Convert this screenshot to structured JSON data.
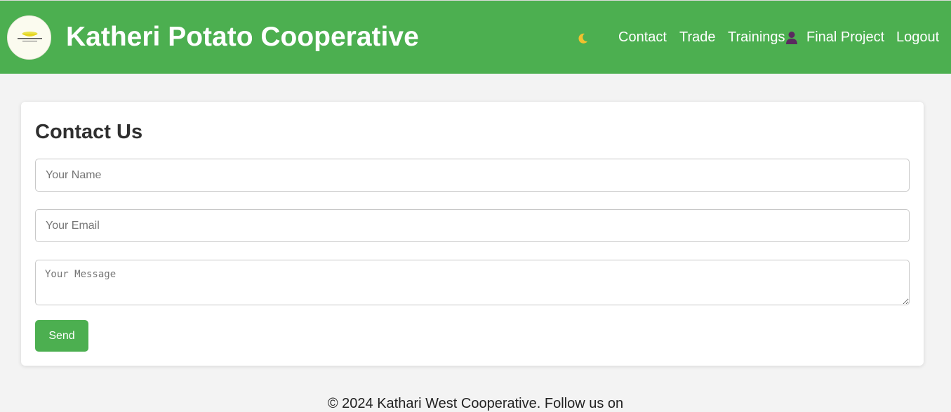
{
  "header": {
    "title": "Katheri Potato Cooperative",
    "logo_icon": "cooperative-logo-icon",
    "theme_toggle_icon": "moon-icon",
    "nav": {
      "contact": "Contact",
      "trade": "Trade",
      "trainings": "Trainings",
      "user_icon": "user-icon",
      "final_project": "Final Project",
      "logout": "Logout"
    },
    "colors": {
      "bar": "#4caf50",
      "text": "#ffffff"
    }
  },
  "contact_form": {
    "title": "Contact Us",
    "name_placeholder": "Your Name",
    "email_placeholder": "Your Email",
    "message_placeholder": "Your Message",
    "send_label": "Send"
  },
  "footer": {
    "text": "© 2024 Kathari West Cooperative. Follow us on"
  }
}
